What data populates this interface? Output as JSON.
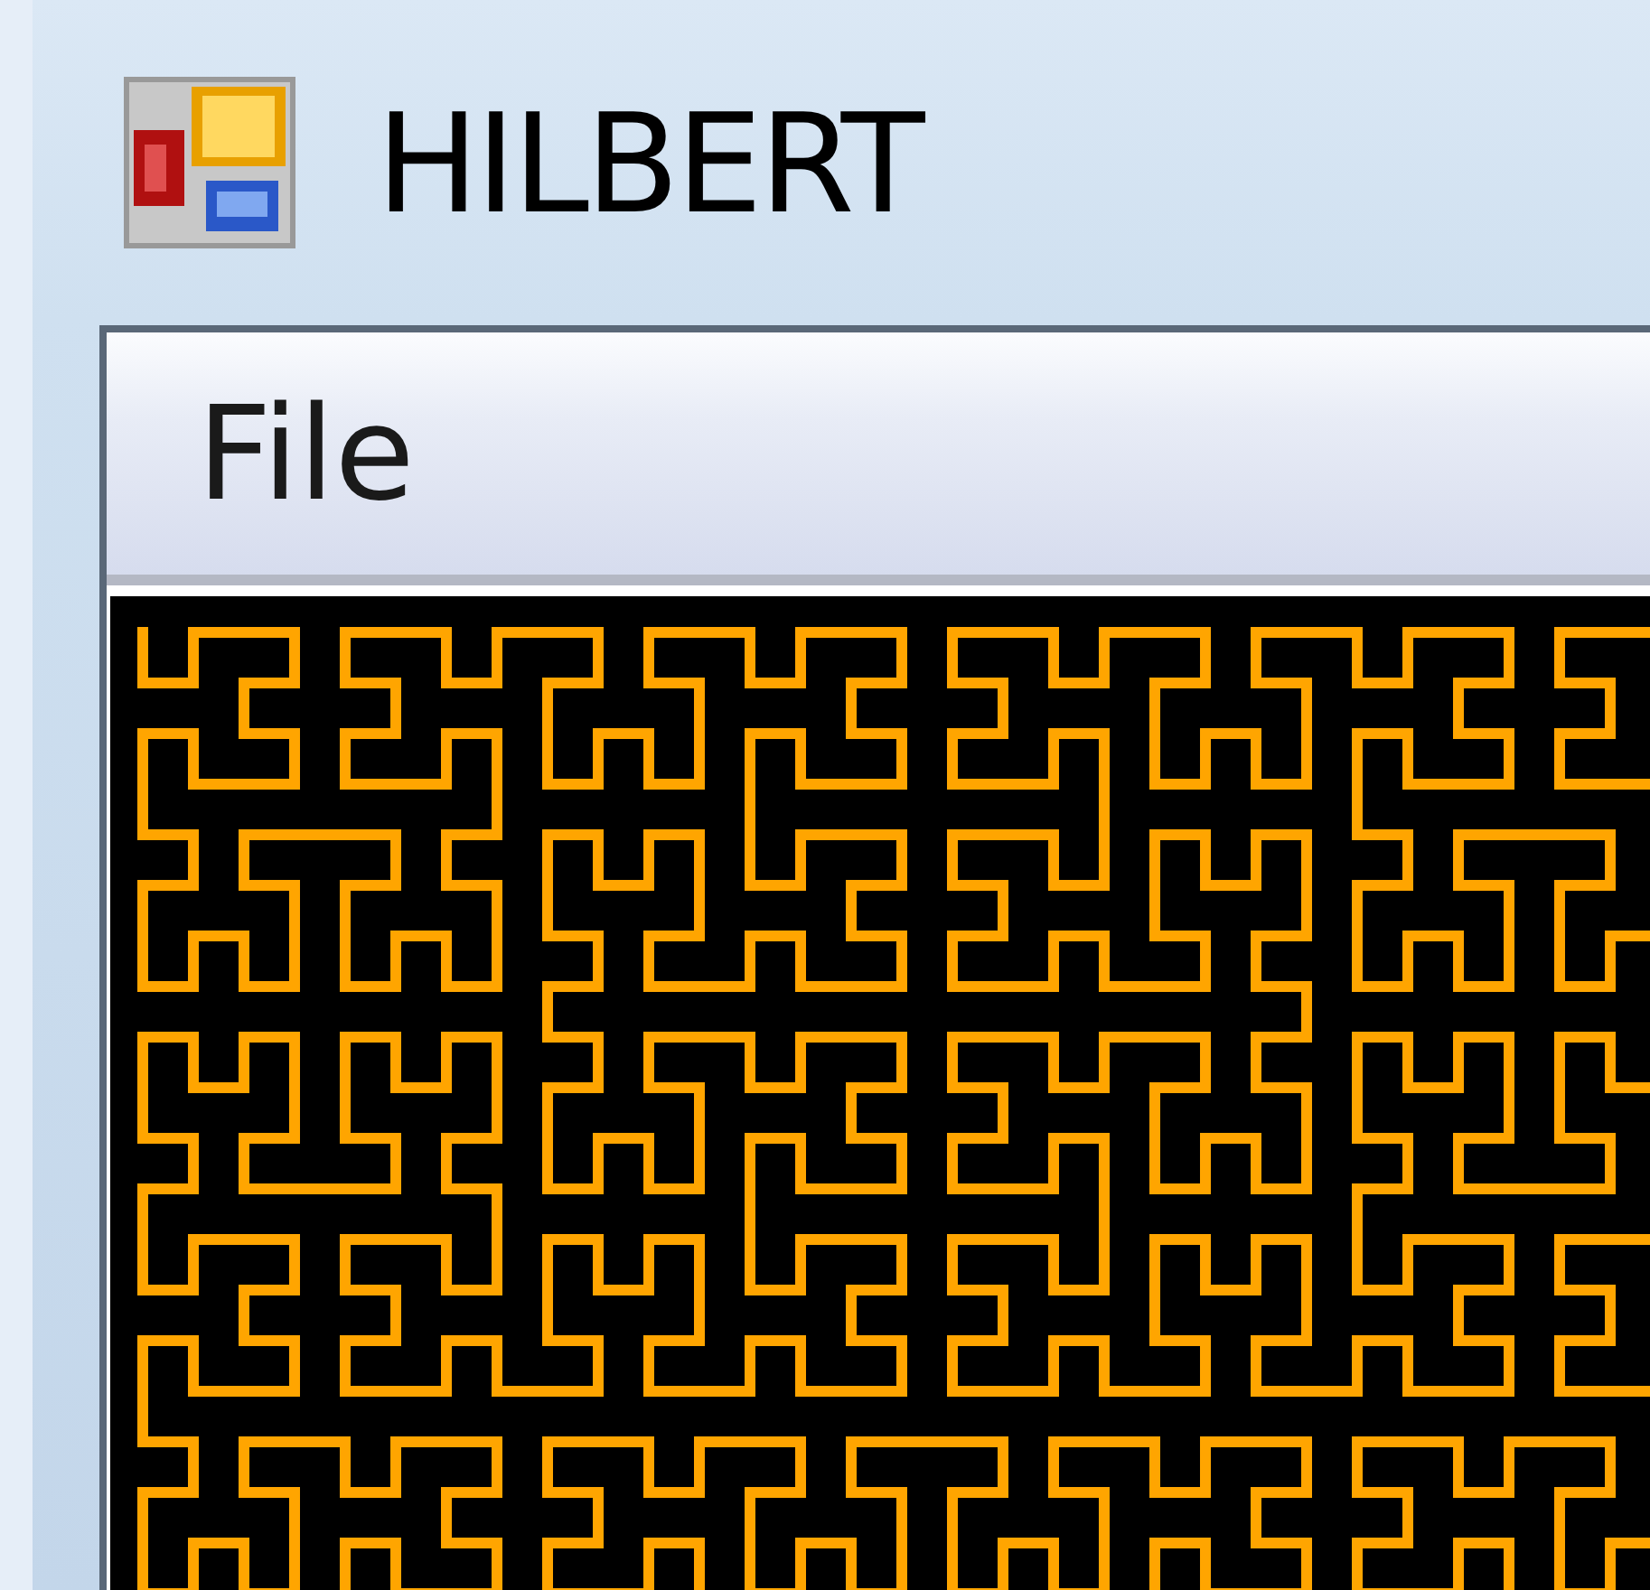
{
  "window": {
    "title": "HILBERT"
  },
  "menu": [
    {
      "label": "File"
    }
  ]
}
